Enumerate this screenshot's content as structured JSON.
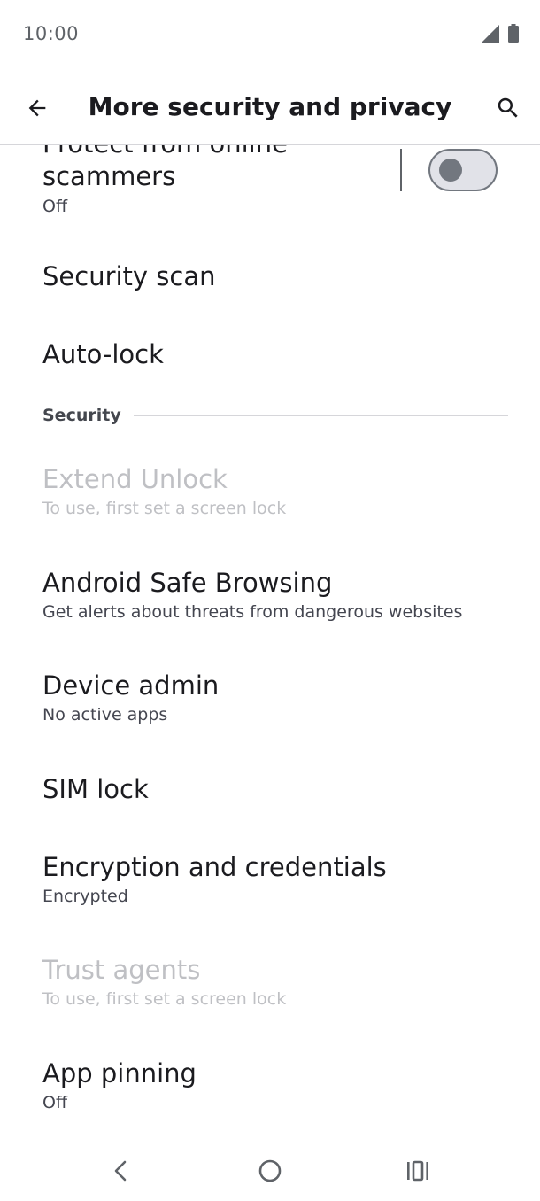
{
  "status_bar": {
    "time": "10:00",
    "icons": [
      "cell-signal-icon",
      "battery-icon"
    ]
  },
  "app_bar": {
    "title": "More security and privacy",
    "back_icon": "arrow-back-icon",
    "search_icon": "search-icon"
  },
  "scam_protection": {
    "title": "Protect from online scammers",
    "summary": "Off",
    "toggle_on": false
  },
  "items_top": [
    {
      "title": "Security scan"
    },
    {
      "title": "Auto-lock"
    }
  ],
  "section": {
    "label": "Security"
  },
  "security_items": [
    {
      "title": "Extend Unlock",
      "summary": "To use, first set a screen lock",
      "enabled": false
    },
    {
      "title": "Android Safe Browsing",
      "summary": "Get alerts about threats from dangerous websites",
      "enabled": true
    },
    {
      "title": "Device admin",
      "summary": "No active apps",
      "enabled": true
    },
    {
      "title": "SIM lock",
      "enabled": true
    },
    {
      "title": "Encryption and credentials",
      "summary": "Encrypted",
      "enabled": true
    },
    {
      "title": "Trust agents",
      "summary": "To use, first set a screen lock",
      "enabled": false
    },
    {
      "title": "App pinning",
      "summary": "Off",
      "enabled": true
    }
  ],
  "nav_bar": {
    "icons": [
      "nav-back-icon",
      "nav-home-icon",
      "nav-recents-icon"
    ]
  },
  "colors": {
    "text_primary": "#1b1b1f",
    "text_disabled": "#bfc0c4",
    "toggle_track": "#e1e2e8",
    "toggle_knob": "#72777f"
  }
}
